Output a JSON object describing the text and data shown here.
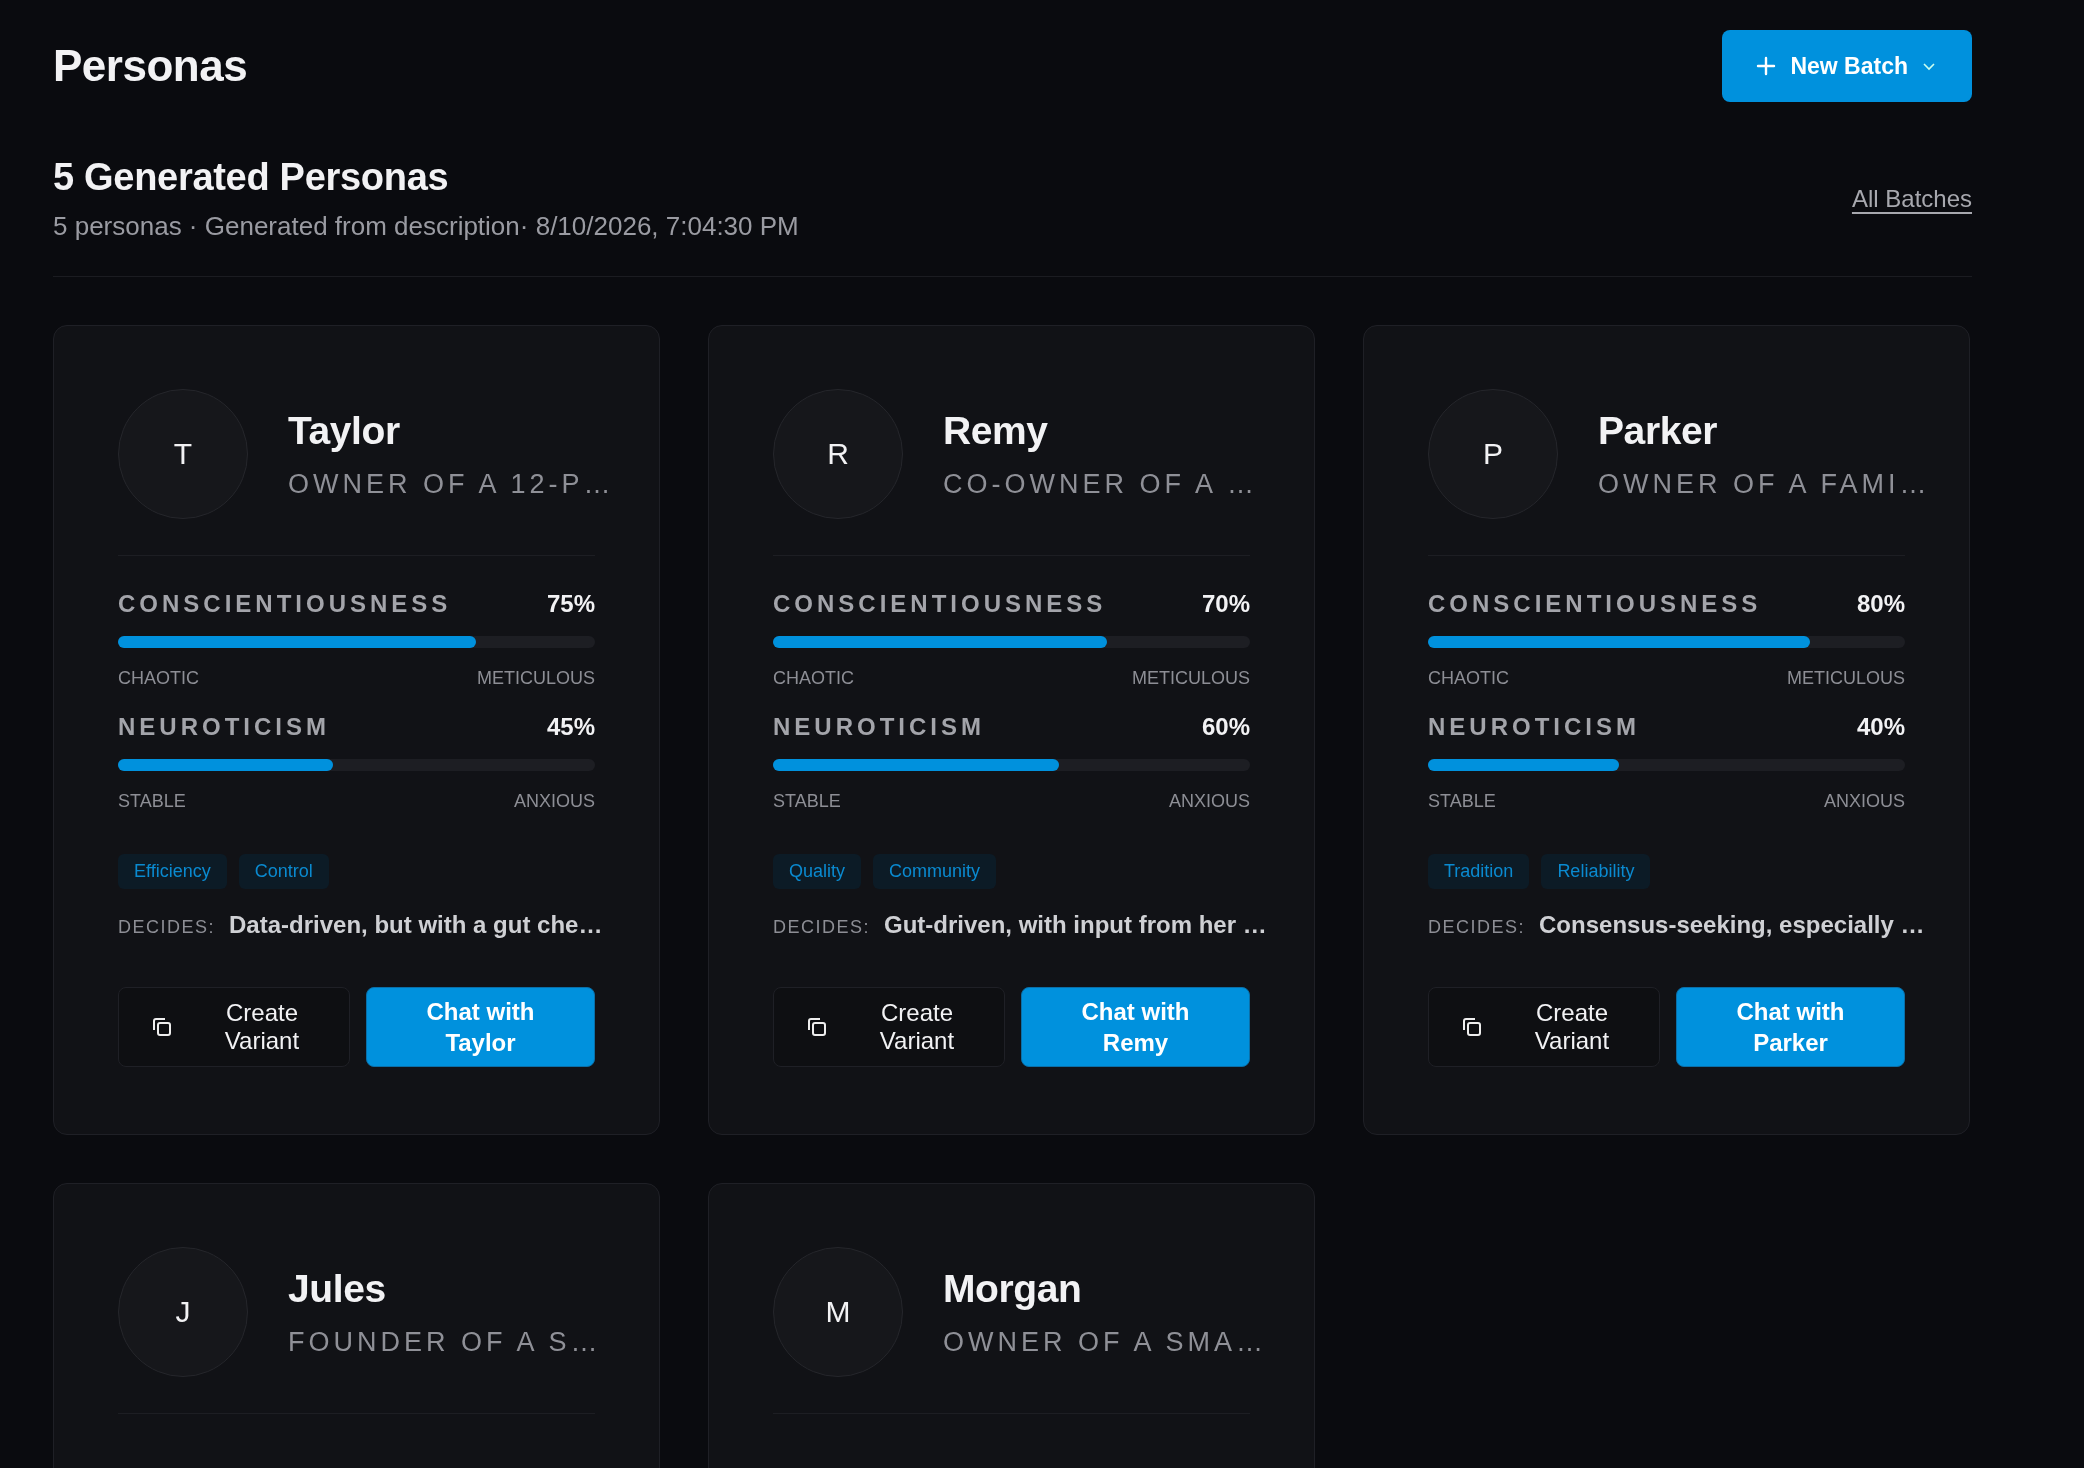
{
  "page": {
    "title": "Personas",
    "new_button": {
      "label": "New Batch"
    }
  },
  "batch": {
    "heading": "5 Generated Personas",
    "meta": "5 personas · Generated from description· 8/10/2026, 7:04:30 PM",
    "all_link": "All Batches"
  },
  "personas": [
    {
      "initial": "T",
      "name": "Taylor",
      "role": "OWNER OF A 12-P…",
      "traits": [
        {
          "label": "CONSCIENTIOUSNESS",
          "value": "75%",
          "level": 0.75,
          "low": "CHAOTIC",
          "high": "METICULOUS"
        },
        {
          "label": "NEUROTICISM",
          "value": "45%",
          "level": 0.45,
          "low": "STABLE",
          "high": "ANXIOUS"
        }
      ],
      "tags": [
        "Efficiency",
        "Control"
      ],
      "decides_label": "DECIDES:",
      "decides": "Data-driven, but with a gut che…",
      "variant_button": "Create Variant",
      "chat_button": "Chat with Taylor"
    },
    {
      "initial": "R",
      "name": "Remy",
      "role": "CO-OWNER OF A …",
      "traits": [
        {
          "label": "CONSCIENTIOUSNESS",
          "value": "70%",
          "level": 0.7,
          "low": "CHAOTIC",
          "high": "METICULOUS"
        },
        {
          "label": "NEUROTICISM",
          "value": "60%",
          "level": 0.6,
          "low": "STABLE",
          "high": "ANXIOUS"
        }
      ],
      "tags": [
        "Quality",
        "Community"
      ],
      "decides_label": "DECIDES:",
      "decides": "Gut-driven, with input from her …",
      "variant_button": "Create Variant",
      "chat_button": "Chat with Remy"
    },
    {
      "initial": "P",
      "name": "Parker",
      "role": "OWNER OF A FAMI…",
      "traits": [
        {
          "label": "CONSCIENTIOUSNESS",
          "value": "80%",
          "level": 0.8,
          "low": "CHAOTIC",
          "high": "METICULOUS"
        },
        {
          "label": "NEUROTICISM",
          "value": "40%",
          "level": 0.4,
          "low": "STABLE",
          "high": "ANXIOUS"
        }
      ],
      "tags": [
        "Tradition",
        "Reliability"
      ],
      "decides_label": "DECIDES:",
      "decides": "Consensus-seeking, especially …",
      "variant_button": "Create Variant",
      "chat_button": "Chat with Parker"
    },
    {
      "initial": "J",
      "name": "Jules",
      "role": "FOUNDER OF A S…"
    },
    {
      "initial": "M",
      "name": "Morgan",
      "role": "OWNER OF A SMA…"
    }
  ]
}
